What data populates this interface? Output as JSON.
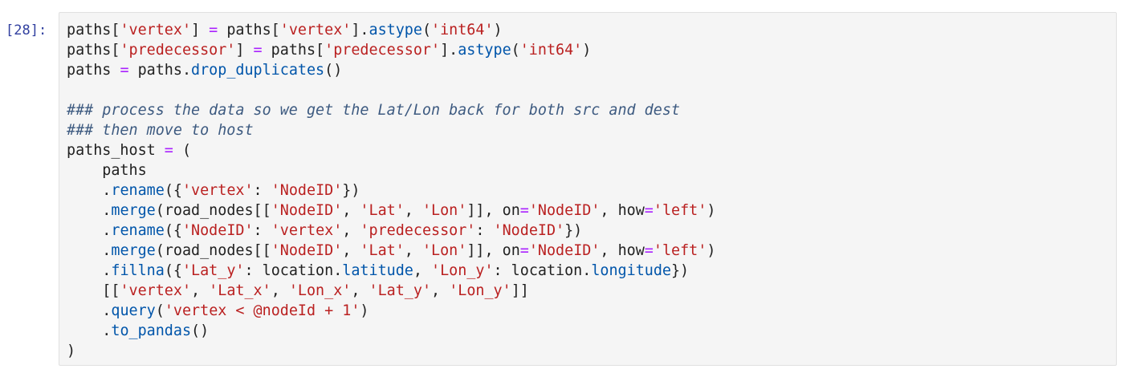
{
  "cell": {
    "prompt": "[28]:",
    "lines": [
      [
        [
          "p",
          "paths["
        ],
        [
          "s",
          "'vertex'"
        ],
        [
          "p",
          "] "
        ],
        [
          "o",
          "="
        ],
        [
          "p",
          " paths["
        ],
        [
          "s",
          "'vertex'"
        ],
        [
          "p",
          "]."
        ],
        [
          "a",
          "astype"
        ],
        [
          "p",
          "("
        ],
        [
          "s",
          "'int64'"
        ],
        [
          "p",
          ")"
        ]
      ],
      [
        [
          "p",
          "paths["
        ],
        [
          "s",
          "'predecessor'"
        ],
        [
          "p",
          "] "
        ],
        [
          "o",
          "="
        ],
        [
          "p",
          " paths["
        ],
        [
          "s",
          "'predecessor'"
        ],
        [
          "p",
          "]."
        ],
        [
          "a",
          "astype"
        ],
        [
          "p",
          "("
        ],
        [
          "s",
          "'int64'"
        ],
        [
          "p",
          ")"
        ]
      ],
      [
        [
          "p",
          "paths "
        ],
        [
          "o",
          "="
        ],
        [
          "p",
          " paths."
        ],
        [
          "a",
          "drop_duplicates"
        ],
        [
          "p",
          "()"
        ]
      ],
      [],
      [
        [
          "cm",
          "### process the data so we get the Lat/Lon back for both src and dest"
        ]
      ],
      [
        [
          "cm",
          "### then move to host"
        ]
      ],
      [
        [
          "p",
          "paths_host "
        ],
        [
          "o",
          "="
        ],
        [
          "p",
          " ("
        ]
      ],
      [
        [
          "p",
          "    paths"
        ]
      ],
      [
        [
          "p",
          "    ."
        ],
        [
          "a",
          "rename"
        ],
        [
          "p",
          "({"
        ],
        [
          "s",
          "'vertex'"
        ],
        [
          "p",
          ": "
        ],
        [
          "s",
          "'NodeID'"
        ],
        [
          "p",
          "})"
        ]
      ],
      [
        [
          "p",
          "    ."
        ],
        [
          "a",
          "merge"
        ],
        [
          "p",
          "(road_nodes[["
        ],
        [
          "s",
          "'NodeID'"
        ],
        [
          "p",
          ", "
        ],
        [
          "s",
          "'Lat'"
        ],
        [
          "p",
          ", "
        ],
        [
          "s",
          "'Lon'"
        ],
        [
          "p",
          "]], on"
        ],
        [
          "o",
          "="
        ],
        [
          "s",
          "'NodeID'"
        ],
        [
          "p",
          ", how"
        ],
        [
          "o",
          "="
        ],
        [
          "s",
          "'left'"
        ],
        [
          "p",
          ")"
        ]
      ],
      [
        [
          "p",
          "    ."
        ],
        [
          "a",
          "rename"
        ],
        [
          "p",
          "({"
        ],
        [
          "s",
          "'NodeID'"
        ],
        [
          "p",
          ": "
        ],
        [
          "s",
          "'vertex'"
        ],
        [
          "p",
          ", "
        ],
        [
          "s",
          "'predecessor'"
        ],
        [
          "p",
          ": "
        ],
        [
          "s",
          "'NodeID'"
        ],
        [
          "p",
          "})"
        ]
      ],
      [
        [
          "p",
          "    ."
        ],
        [
          "a",
          "merge"
        ],
        [
          "p",
          "(road_nodes[["
        ],
        [
          "s",
          "'NodeID'"
        ],
        [
          "p",
          ", "
        ],
        [
          "s",
          "'Lat'"
        ],
        [
          "p",
          ", "
        ],
        [
          "s",
          "'Lon'"
        ],
        [
          "p",
          "]], on"
        ],
        [
          "o",
          "="
        ],
        [
          "s",
          "'NodeID'"
        ],
        [
          "p",
          ", how"
        ],
        [
          "o",
          "="
        ],
        [
          "s",
          "'left'"
        ],
        [
          "p",
          ")"
        ]
      ],
      [
        [
          "p",
          "    ."
        ],
        [
          "a",
          "fillna"
        ],
        [
          "p",
          "({"
        ],
        [
          "s",
          "'Lat_y'"
        ],
        [
          "p",
          ": location."
        ],
        [
          "a",
          "latitude"
        ],
        [
          "p",
          ", "
        ],
        [
          "s",
          "'Lon_y'"
        ],
        [
          "p",
          ": location."
        ],
        [
          "a",
          "longitude"
        ],
        [
          "p",
          "})"
        ]
      ],
      [
        [
          "p",
          "    [["
        ],
        [
          "s",
          "'vertex'"
        ],
        [
          "p",
          ", "
        ],
        [
          "s",
          "'Lat_x'"
        ],
        [
          "p",
          ", "
        ],
        [
          "s",
          "'Lon_x'"
        ],
        [
          "p",
          ", "
        ],
        [
          "s",
          "'Lat_y'"
        ],
        [
          "p",
          ", "
        ],
        [
          "s",
          "'Lon_y'"
        ],
        [
          "p",
          "]]"
        ]
      ],
      [
        [
          "p",
          "    ."
        ],
        [
          "a",
          "query"
        ],
        [
          "p",
          "("
        ],
        [
          "s",
          "'vertex < @nodeId + 1'"
        ],
        [
          "p",
          ")"
        ]
      ],
      [
        [
          "p",
          "    ."
        ],
        [
          "a",
          "to_pandas"
        ],
        [
          "p",
          "()"
        ]
      ],
      [
        [
          "p",
          ")"
        ]
      ]
    ]
  }
}
